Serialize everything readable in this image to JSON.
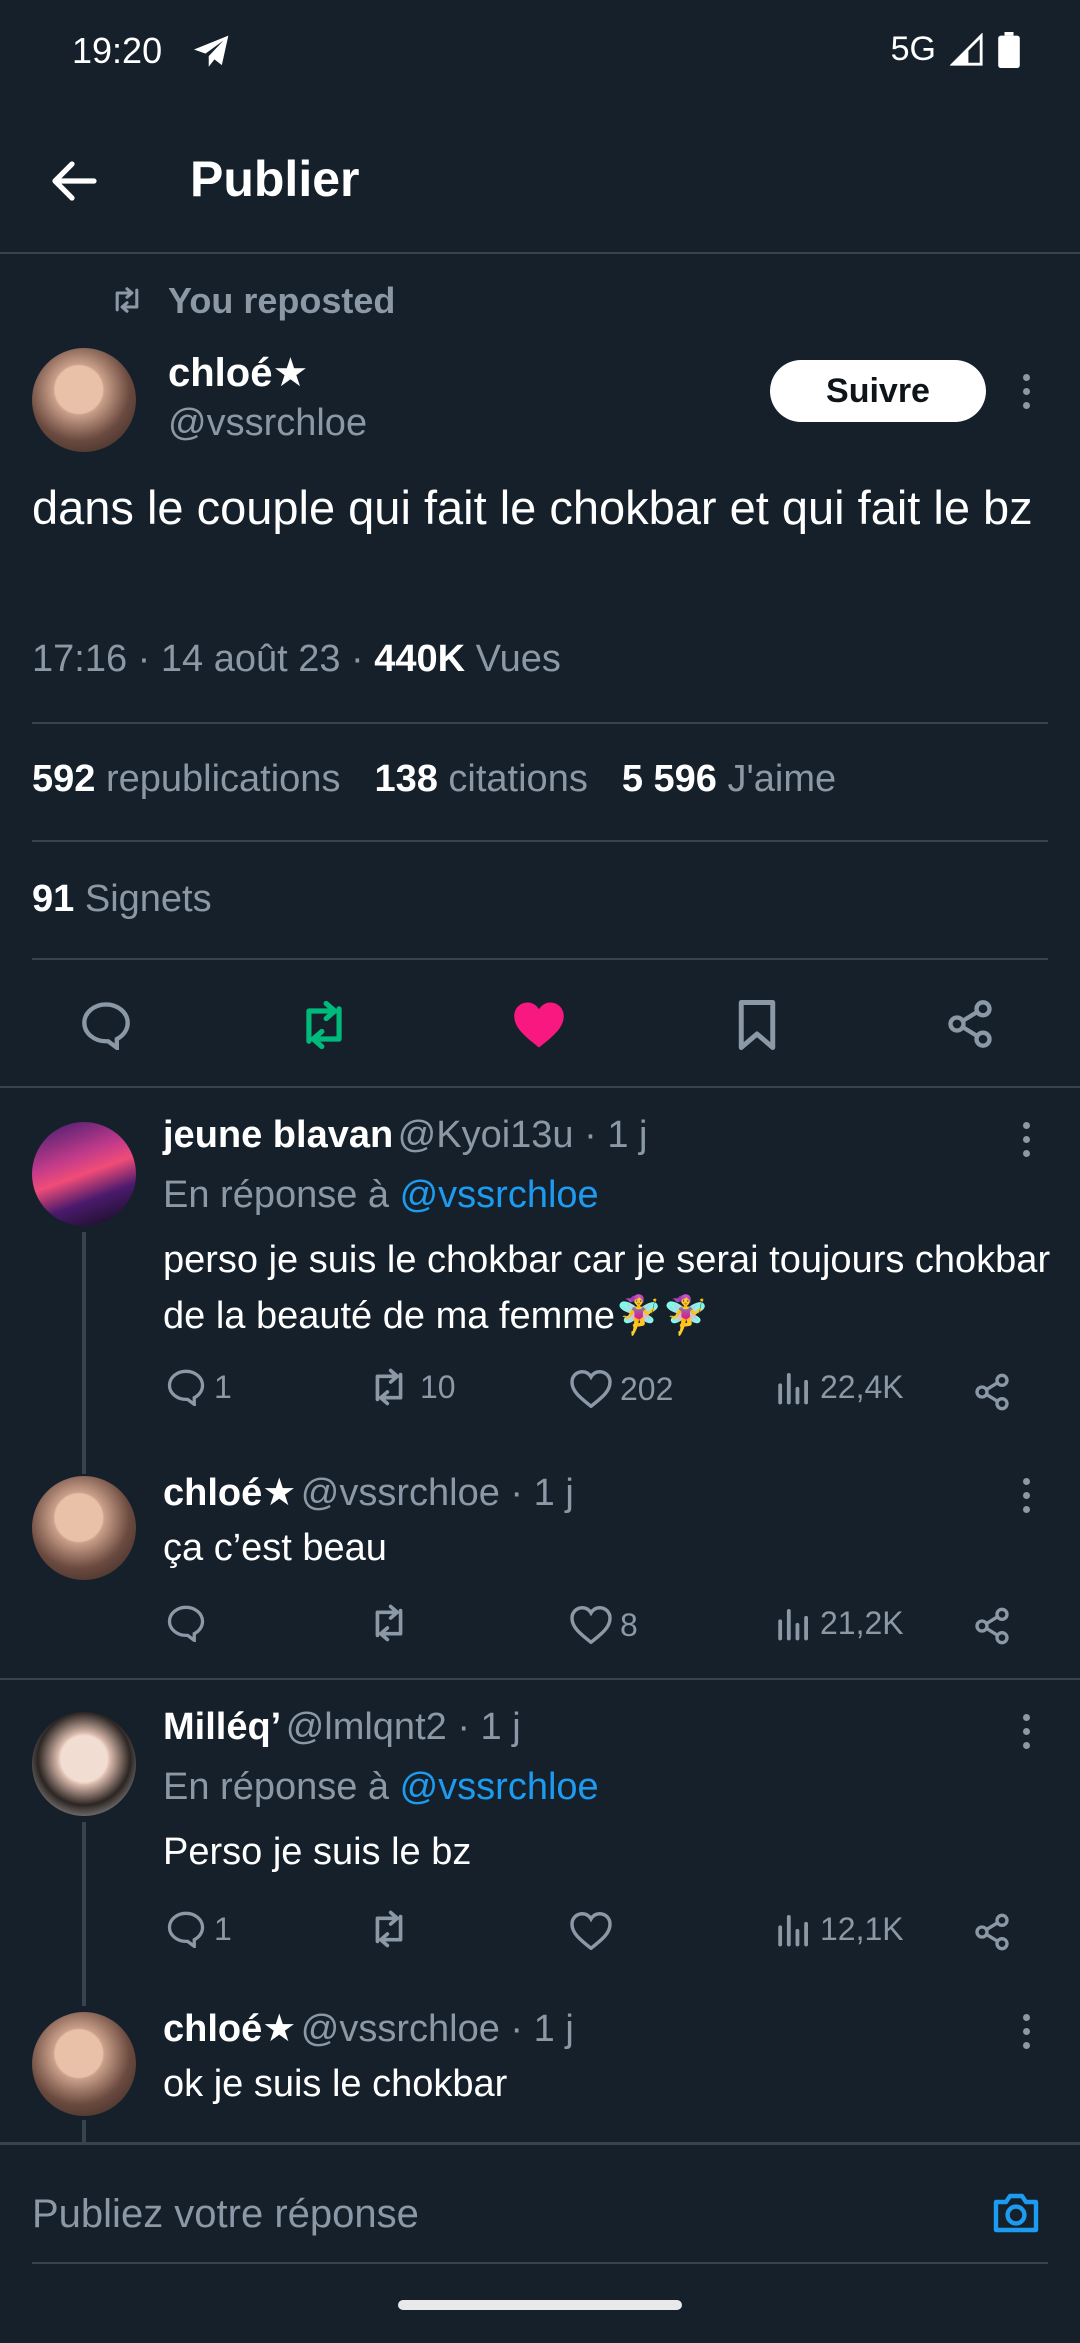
{
  "status_bar": {
    "time": "19:20",
    "network": "5G"
  },
  "header": {
    "title": "Publier"
  },
  "repost": {
    "label": "You reposted"
  },
  "tweet": {
    "author_name": "chloé★",
    "author_handle": "@vssrchloe",
    "follow_label": "Suivre",
    "text": "dans le couple qui fait le chokbar et qui fait le bz",
    "time": "17:16 · 14 août 23 · ",
    "views_count": "440K",
    "views_label": " Vues",
    "reposts_count": "592",
    "reposts_label": "republications",
    "quotes_count": "138",
    "quotes_label": "citations",
    "likes_count": "5 596",
    "likes_label": "J'aime",
    "bookmarks_count": "91",
    "bookmarks_label": "Signets"
  },
  "replies": [
    {
      "name": "jeune blavan",
      "handle": "@Kyoi13u · 1 j",
      "reply_to_prefix": "En réponse à ",
      "reply_to_handle": "@vssrchloe",
      "text": "perso je suis le chokbar car je serai toujours chokbar de la beauté de ma femme🧚‍♀️🧚‍♀️",
      "replies": "1",
      "reposts": "10",
      "likes": "202",
      "views": "22,4K"
    },
    {
      "name": "chloé★",
      "handle": "@vssrchloe · 1 j",
      "text": "ça c’est beau",
      "replies": "",
      "reposts": "",
      "likes": "8",
      "views": "21,2K"
    },
    {
      "name": "Milléq’",
      "handle": "@lmlqnt2 · 1 j",
      "reply_to_prefix": "En réponse à ",
      "reply_to_handle": "@vssrchloe",
      "text": "Perso je suis le bz",
      "replies": "1",
      "reposts": "",
      "likes": "",
      "views": "12,1K"
    },
    {
      "name": "chloé★",
      "handle": "@vssrchloe · 1 j",
      "text": "ok je suis le chokbar"
    }
  ],
  "composer": {
    "placeholder": "Publiez votre réponse"
  },
  "colors": {
    "background": "#15202b",
    "accent": "#1d9bf0",
    "like": "#f91880",
    "repost": "#00ba7c",
    "muted": "#8b98a5"
  }
}
